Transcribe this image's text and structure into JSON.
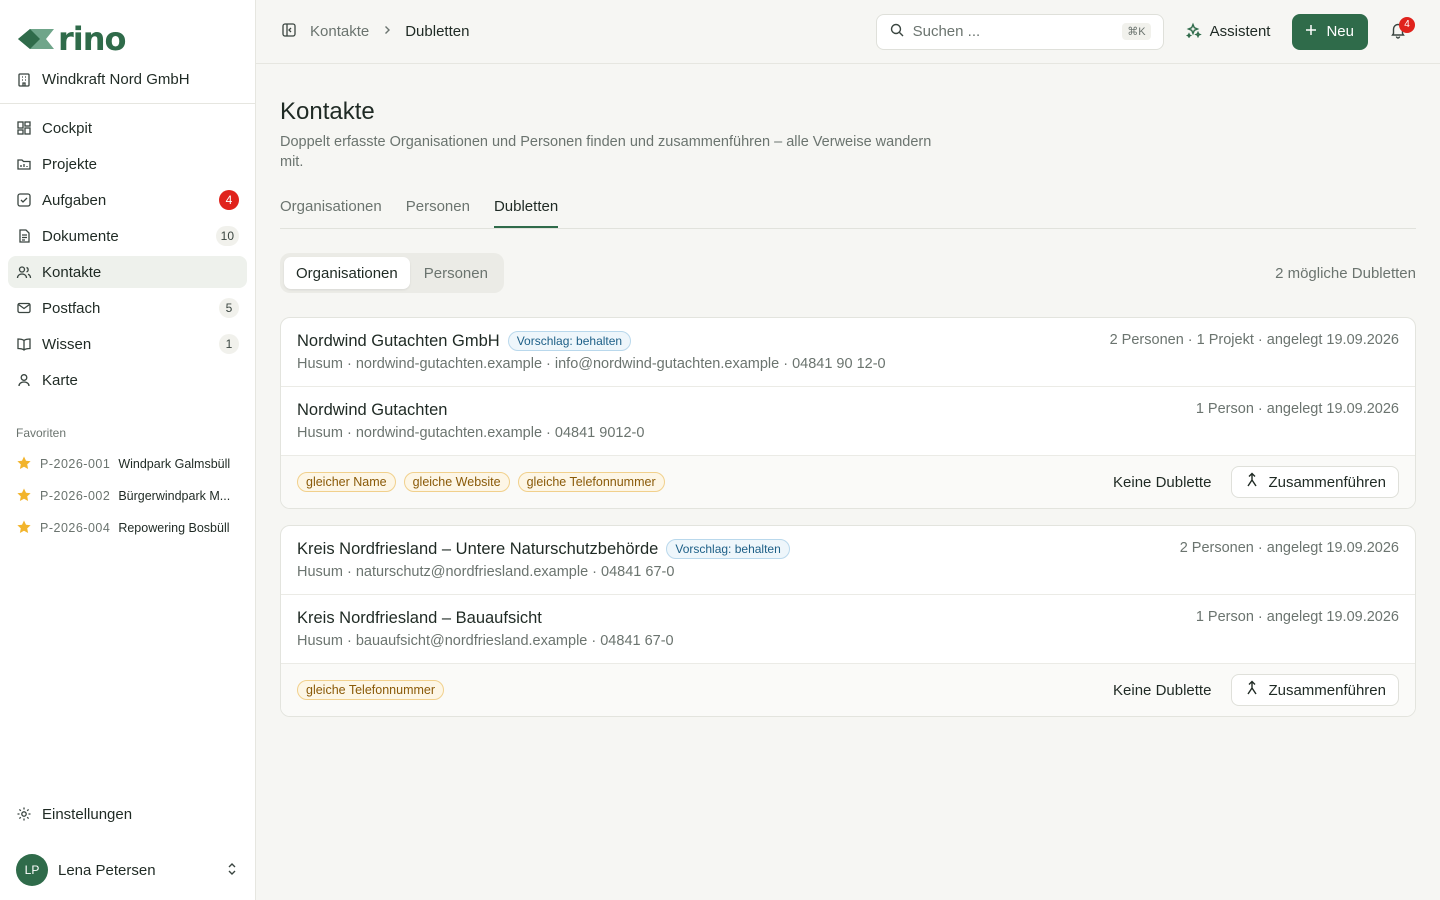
{
  "brand": {
    "logo_text": "rino",
    "color": "#2f6b4a"
  },
  "org_name": "Windkraft Nord GmbH",
  "sidebar": {
    "items": [
      {
        "label": "Cockpit",
        "icon": "dashboard-icon",
        "count": ""
      },
      {
        "label": "Projekte",
        "icon": "folder-icon",
        "count": ""
      },
      {
        "label": "Aufgaben",
        "icon": "checkbox-icon",
        "count": "4"
      },
      {
        "label": "Dokumente",
        "icon": "document-icon",
        "count": "10"
      },
      {
        "label": "Kontakte",
        "icon": "users-icon",
        "count": ""
      },
      {
        "label": "Postfach",
        "icon": "mail-icon",
        "count": "5"
      },
      {
        "label": "Wissen",
        "icon": "book-icon",
        "count": "1"
      },
      {
        "label": "Karte",
        "icon": "map-pin-icon",
        "count": ""
      }
    ],
    "favorites_title": "Favoriten",
    "favorites": [
      {
        "code": "P-2026-001",
        "name": "Windpark Galmsbüll"
      },
      {
        "code": "P-2026-002",
        "name": "Bürgerwindpark M..."
      },
      {
        "code": "P-2026-004",
        "name": "Repowering Bosbüll"
      }
    ],
    "settings_label": "Einstellungen",
    "user": {
      "initials": "LP",
      "name": "Lena Petersen"
    }
  },
  "topbar": {
    "breadcrumb": [
      "Kontakte",
      "Dubletten"
    ],
    "search_placeholder": "Suchen ...",
    "search_shortcut": "⌘K",
    "assistant_label": "Assistent",
    "new_label": "Neu",
    "notification_count": "4"
  },
  "page": {
    "title": "Kontakte",
    "subtitle": "Doppelt erfasste Organisationen und Personen finden und zusammenführen – alle Verweise wandern mit.",
    "tabs": [
      "Organisationen",
      "Personen",
      "Dubletten"
    ],
    "active_tab": "Dubletten",
    "segment": [
      "Organisationen",
      "Personen"
    ],
    "active_segment": "Organisationen",
    "duplicates_count_text": "2 mögliche Dubletten"
  },
  "groups": [
    {
      "rows": [
        {
          "name": "Nordwind Gutachten GmbH",
          "badge": "Vorschlag: behalten",
          "details": "Husum · nordwind-gutachten.example · info@nordwind-gutachten.example · 04841 90 12-0",
          "meta": "2 Personen · 1 Projekt · angelegt 19.09.2026"
        },
        {
          "name": "Nordwind Gutachten",
          "badge": "",
          "details": "Husum · nordwind-gutachten.example · 04841 9012-0",
          "meta": "1 Person · angelegt 19.09.2026"
        }
      ],
      "reasons": [
        "gleicher Name",
        "gleiche Website",
        "gleiche Telefonnummer"
      ],
      "no_dup_label": "Keine Dublette",
      "merge_label": "Zusammenführen"
    },
    {
      "rows": [
        {
          "name": "Kreis Nordfriesland – Untere Naturschutzbehörde",
          "badge": "Vorschlag: behalten",
          "details": "Husum · naturschutz@nordfriesland.example · 04841 67-0",
          "meta": "2 Personen · angelegt 19.09.2026"
        },
        {
          "name": "Kreis Nordfriesland – Bauaufsicht",
          "badge": "",
          "details": "Husum · bauaufsicht@nordfriesland.example · 04841 67-0",
          "meta": "1 Person · angelegt 19.09.2026"
        }
      ],
      "reasons": [
        "gleiche Telefonnummer"
      ],
      "no_dup_label": "Keine Dublette",
      "merge_label": "Zusammenführen"
    }
  ]
}
